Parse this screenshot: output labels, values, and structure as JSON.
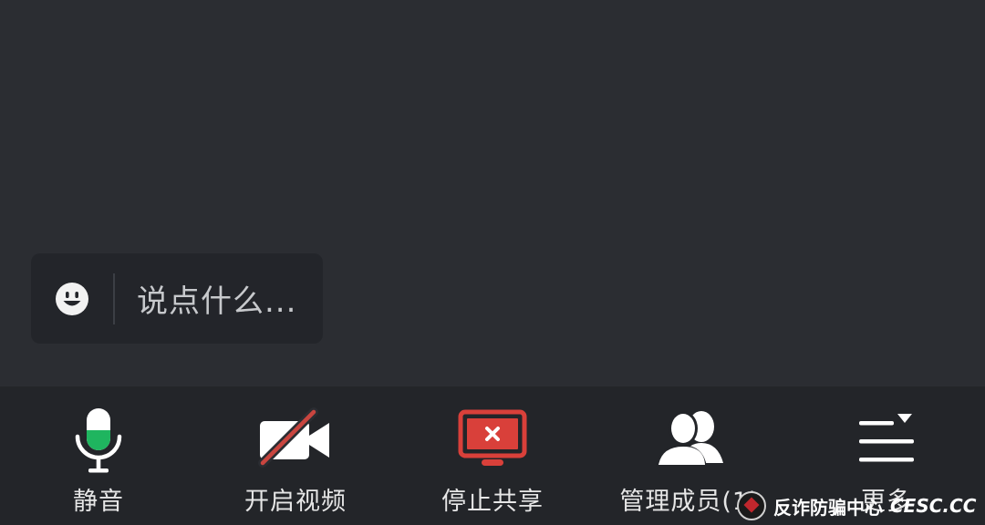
{
  "chat": {
    "emoji_icon": "smiley-icon",
    "placeholder": "说点什么..."
  },
  "toolbar": {
    "items": [
      {
        "label": "静音",
        "icon": "microphone-icon",
        "accent": "#1fb55f"
      },
      {
        "label": "开启视频",
        "icon": "video-off-icon",
        "accent": "#c9453f"
      },
      {
        "label": "停止共享",
        "icon": "stop-share-screen-icon",
        "accent": "#d9403a"
      },
      {
        "label": "管理成员(1)",
        "icon": "members-icon"
      },
      {
        "label": "更多",
        "icon": "more-menu-icon"
      }
    ]
  },
  "watermark": {
    "text": "反诈防骗中心",
    "latin": "CESC.CC"
  },
  "colors": {
    "background": "#2b2d32",
    "toolbar": "#232529",
    "text": "#e6e6e6"
  }
}
